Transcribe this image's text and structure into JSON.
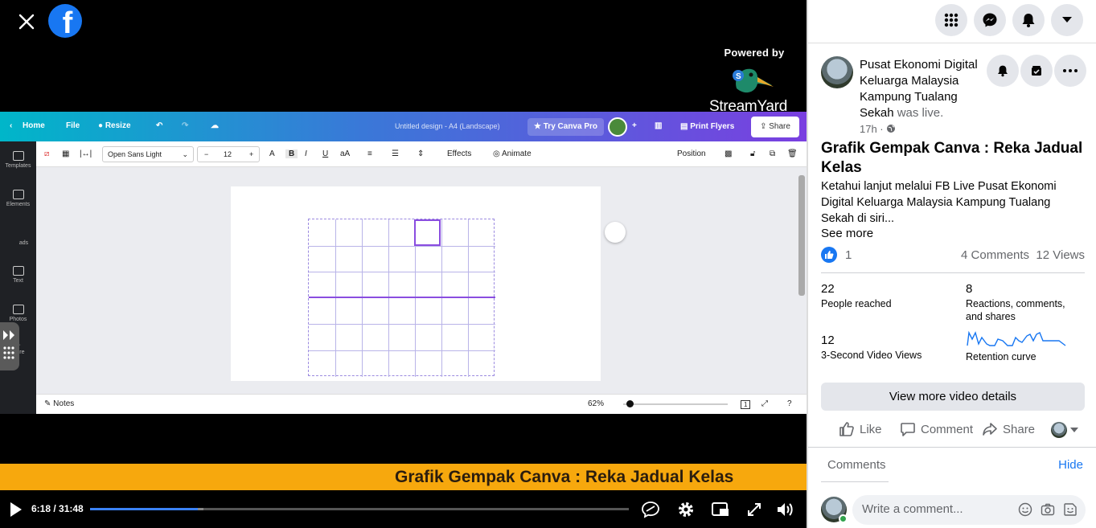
{
  "video": {
    "powered_by": "Powered by",
    "brand": "StreamYard",
    "ticker": "Grafik Gempak Canva : Reka Jadual Kelas",
    "time": "6:18 / 31:48",
    "progress": 0.2,
    "canva": {
      "home": "Home",
      "file": "File",
      "resize": "Resize",
      "doc_title": "Untitled design - A4 (Landscape)",
      "try_pro": "Try Canva Pro",
      "print": "Print Flyers",
      "share": "Share",
      "font": "Open Sans Light",
      "size": "12",
      "effects": "Effects",
      "animate": "Animate",
      "position": "Position",
      "notes": "Notes",
      "zoom": "62%",
      "page_num": "1",
      "sidebar": [
        "Templates",
        "Elements",
        "ads",
        "Text",
        "Photos",
        "More"
      ]
    }
  },
  "post": {
    "page_name": "Pusat Ekonomi Digital Keluarga Malaysia Kampung Tualang Sekah",
    "was_live": "was live.",
    "time": "17h ·",
    "title": "Grafik Gempak Canva : Reka Jadual Kelas",
    "description": "Ketahui lanjut melalui FB Live Pusat Ekonomi Digital Keluarga Malaysia Kampung Tualang Sekah di siri...",
    "see_more": "See more",
    "likes": "1",
    "comments_count": "4 Comments",
    "views": "12 Views",
    "stats": {
      "reached_num": "22",
      "reached_label": "People reached",
      "reactions_num": "8",
      "reactions_label": "Reactions, comments, and shares",
      "views_num": "12",
      "views_label": "3-Second Video Views",
      "retention_label": "Retention curve"
    },
    "details_button": "View more video details",
    "actions": {
      "like": "Like",
      "comment": "Comment",
      "share": "Share"
    },
    "comments_label": "Comments",
    "hide": "Hide",
    "comment_placeholder": "Write a comment..."
  },
  "colors": {
    "facebook_blue": "#1877f2",
    "ticker": "#f7a80d",
    "progress": "#3b82f6"
  }
}
